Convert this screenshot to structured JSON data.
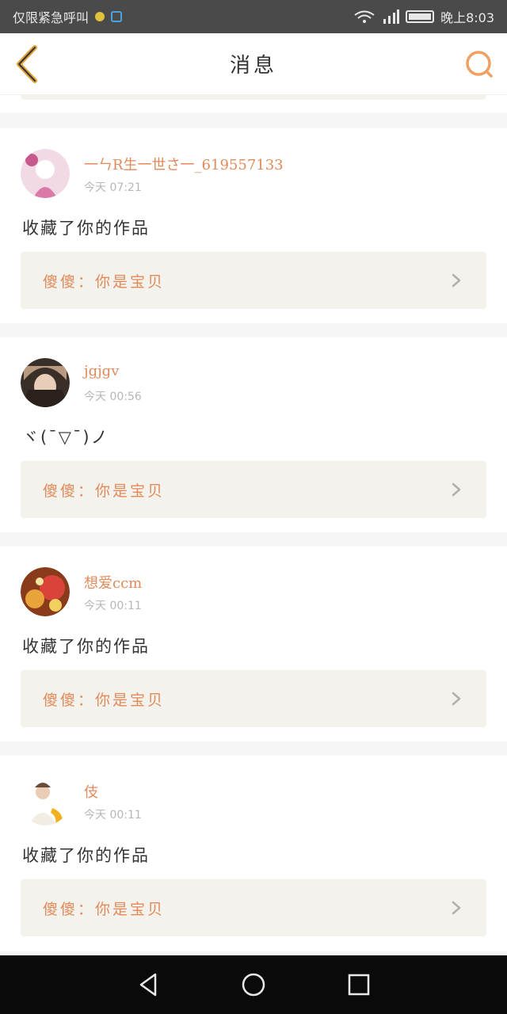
{
  "status_bar": {
    "carrier": "仅限紧急呼叫",
    "time": "晚上8:03"
  },
  "nav": {
    "title": "消息"
  },
  "messages": [
    {
      "username": "一ㄣR生一世さ一_619557133",
      "time": "今天 07:21",
      "text": "收藏了你的作品",
      "quote": "傻傻：你是宝贝"
    },
    {
      "username": "jgjgv",
      "time": "今天 00:56",
      "text": "ヾ(ˉ▽ˉ)ノ",
      "quote": "傻傻：你是宝贝"
    },
    {
      "username": "想爱ccm",
      "time": "今天 00:11",
      "text": "收藏了你的作品",
      "quote": "傻傻：你是宝贝"
    },
    {
      "username": "伎",
      "time": "今天 00:11",
      "text": "收藏了你的作品",
      "quote": "傻傻：你是宝贝"
    }
  ],
  "colors": {
    "accent": "#e28a59",
    "quote_bg": "#f4f2ec",
    "back_icon": "#e2a13b"
  },
  "icons": {
    "back": "chevron-left-icon",
    "search": "search-icon",
    "chevron": "chevron-right-icon",
    "android_back": "triangle-back-icon",
    "android_home": "circle-home-icon",
    "android_recents": "square-recents-icon"
  }
}
